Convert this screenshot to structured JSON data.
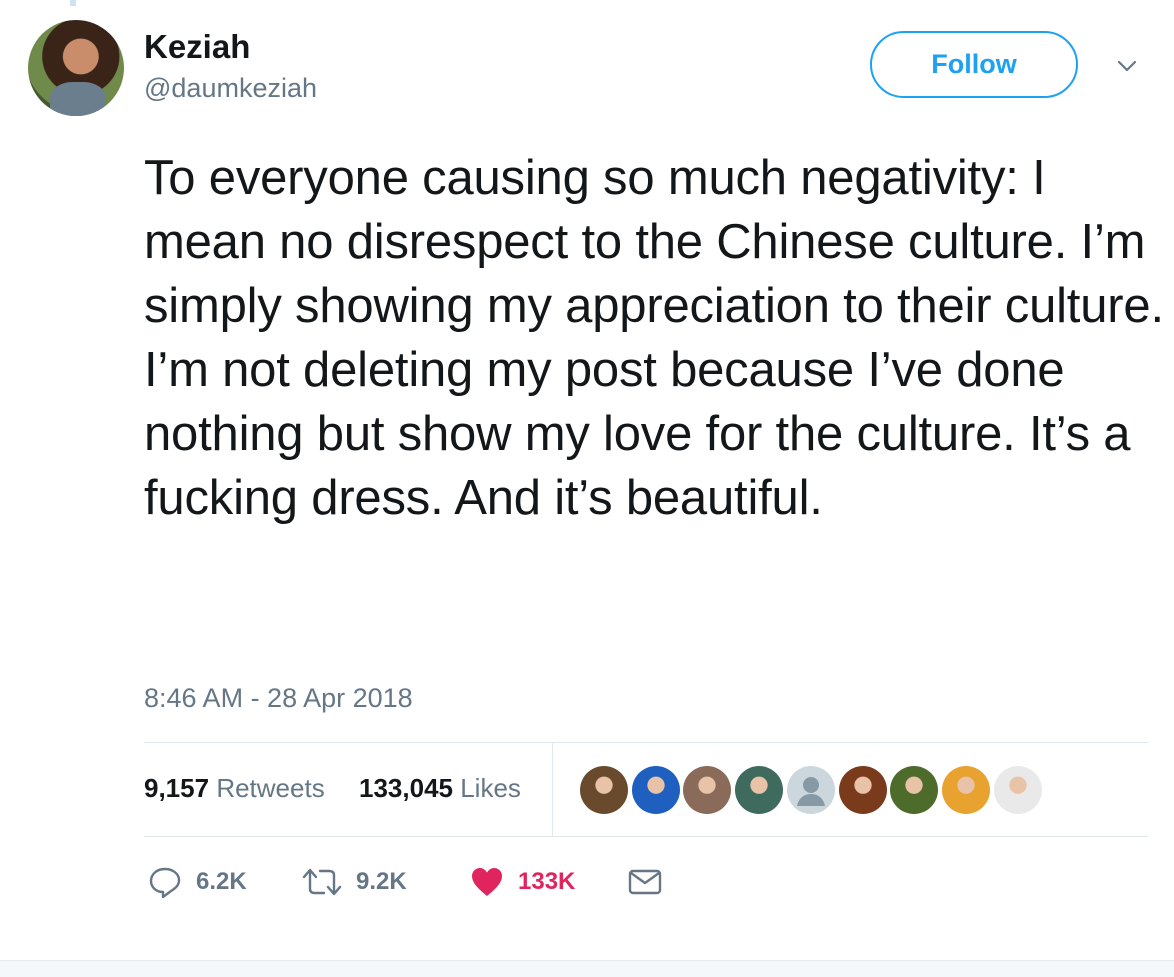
{
  "author": {
    "name": "Keziah",
    "handle": "@daumkeziah"
  },
  "follow_button": {
    "label": "Follow"
  },
  "menu": {
    "icon": "chevron-down-icon"
  },
  "tweet": {
    "text": "To everyone causing so much negativity: I mean no disrespect to the Chinese culture. I’m simply showing my appreciation to their culture. I’m not deleting my post because I’ve done nothing but show my love for the culture. It’s a fucking dress. And it’s beautiful.",
    "timestamp": "8:46 AM - 28 Apr 2018"
  },
  "stats": {
    "retweets": {
      "count": "9,157",
      "label": "Retweets"
    },
    "likes": {
      "count": "133,045",
      "label": "Likes"
    }
  },
  "likers": [
    {
      "icon": "avatar-icon",
      "color": "#6a4a2c"
    },
    {
      "icon": "avatar-icon",
      "color": "#1f5fbf"
    },
    {
      "icon": "avatar-icon",
      "color": "#8a6b59"
    },
    {
      "icon": "avatar-icon",
      "color": "#3e6b5e"
    },
    {
      "icon": "default-avatar-icon",
      "color": "#ccd6dd"
    },
    {
      "icon": "avatar-icon",
      "color": "#7a3a1c"
    },
    {
      "icon": "avatar-icon",
      "color": "#4d6b2a"
    },
    {
      "icon": "avatar-icon",
      "color": "#e8a230"
    },
    {
      "icon": "avatar-icon",
      "color": "#e9e9e9"
    }
  ],
  "actions": {
    "reply": {
      "icon": "reply-icon",
      "count": "6.2K"
    },
    "retweet": {
      "icon": "retweet-icon",
      "count": "9.2K"
    },
    "like": {
      "icon": "heart-icon",
      "count": "133K"
    },
    "message": {
      "icon": "envelope-icon"
    }
  },
  "colors": {
    "accent": "#1da1f2",
    "like": "#e0245e",
    "secondary_text": "#657786",
    "primary_text": "#14171a"
  }
}
